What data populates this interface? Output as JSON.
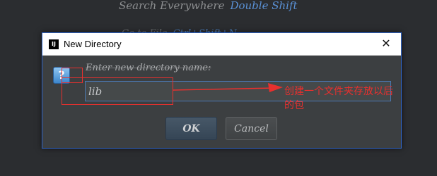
{
  "background": {
    "hint_label": "Search Everywhere",
    "hint_shortcut": "Double Shift",
    "hint2_label": "Go to File",
    "hint2_shortcut": "Ctrl+Shift+N"
  },
  "dialog": {
    "app_icon": "IJ",
    "title": "New Directory",
    "close_symbol": "✕",
    "question_symbol": "?",
    "prompt": "Enter new directory name:",
    "input_value": "lib",
    "ok_label": "OK",
    "cancel_label": "Cancel"
  },
  "annotation": {
    "text": "创建一个文件夹存放以后的包",
    "color": "#e8302e"
  },
  "colors": {
    "background": "#2b2d30",
    "dialog_bg": "#3c3f41",
    "accent": "#4a78b2",
    "shortcut": "#5a91d6"
  },
  "icons": {
    "app": "intellij-logo-icon",
    "close": "close-icon",
    "question": "question-icon"
  }
}
